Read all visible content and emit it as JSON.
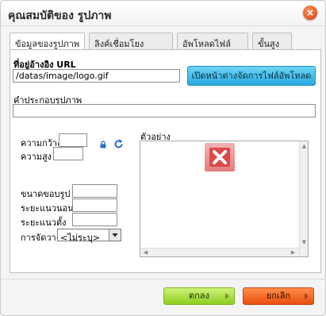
{
  "dialog": {
    "title": "คุณสมบัติของ รูปภาพ",
    "close_symbol": "×"
  },
  "tabs": [
    {
      "label": "ข้อมูลของรูปภาพ",
      "active": true
    },
    {
      "label": "ลิงค์เชื่อมโยง",
      "active": false
    },
    {
      "label": "อัพโหลดไฟล์",
      "active": false
    },
    {
      "label": "ขั้นสูง",
      "active": false
    }
  ],
  "image_info": {
    "url_label": "ที่อยู่อ้างอิง URL",
    "url_value": "/datas/image/logo.gif",
    "browse_button": "เปิดหน้าต่างจัดการไฟล์อัพโหลด",
    "alt_label": "คำประกอบรูปภาพ",
    "alt_value": "",
    "width_label": "ความกว้าง",
    "width_value": "",
    "height_label": "ความสูง",
    "height_value": "",
    "border_label": "ขนาดขอบรูป",
    "border_value": "",
    "hspace_label": "ระยะแนวนอน",
    "hspace_value": "",
    "vspace_label": "ระยะแนวตั้ง",
    "vspace_value": "",
    "align_label": "การจัดวาง",
    "align_selected": "<ไม่ระบุ>",
    "preview_label": "ตัวอย่าง"
  },
  "footer": {
    "ok_button": "ตกลง",
    "cancel_button": "ยกเลิก"
  },
  "colors": {
    "browse_button": "#29a9e0",
    "ok_button": "#8ccf1e",
    "cancel_button": "#e94e0f",
    "close_button": "#e2511b",
    "broken_image": "#e47c7c"
  },
  "icons": {
    "close": "close-icon",
    "lock": "lock-icon",
    "reset_size": "reset-size-icon",
    "broken_image": "broken-image-icon",
    "dropdown": "chevron-down-icon"
  }
}
